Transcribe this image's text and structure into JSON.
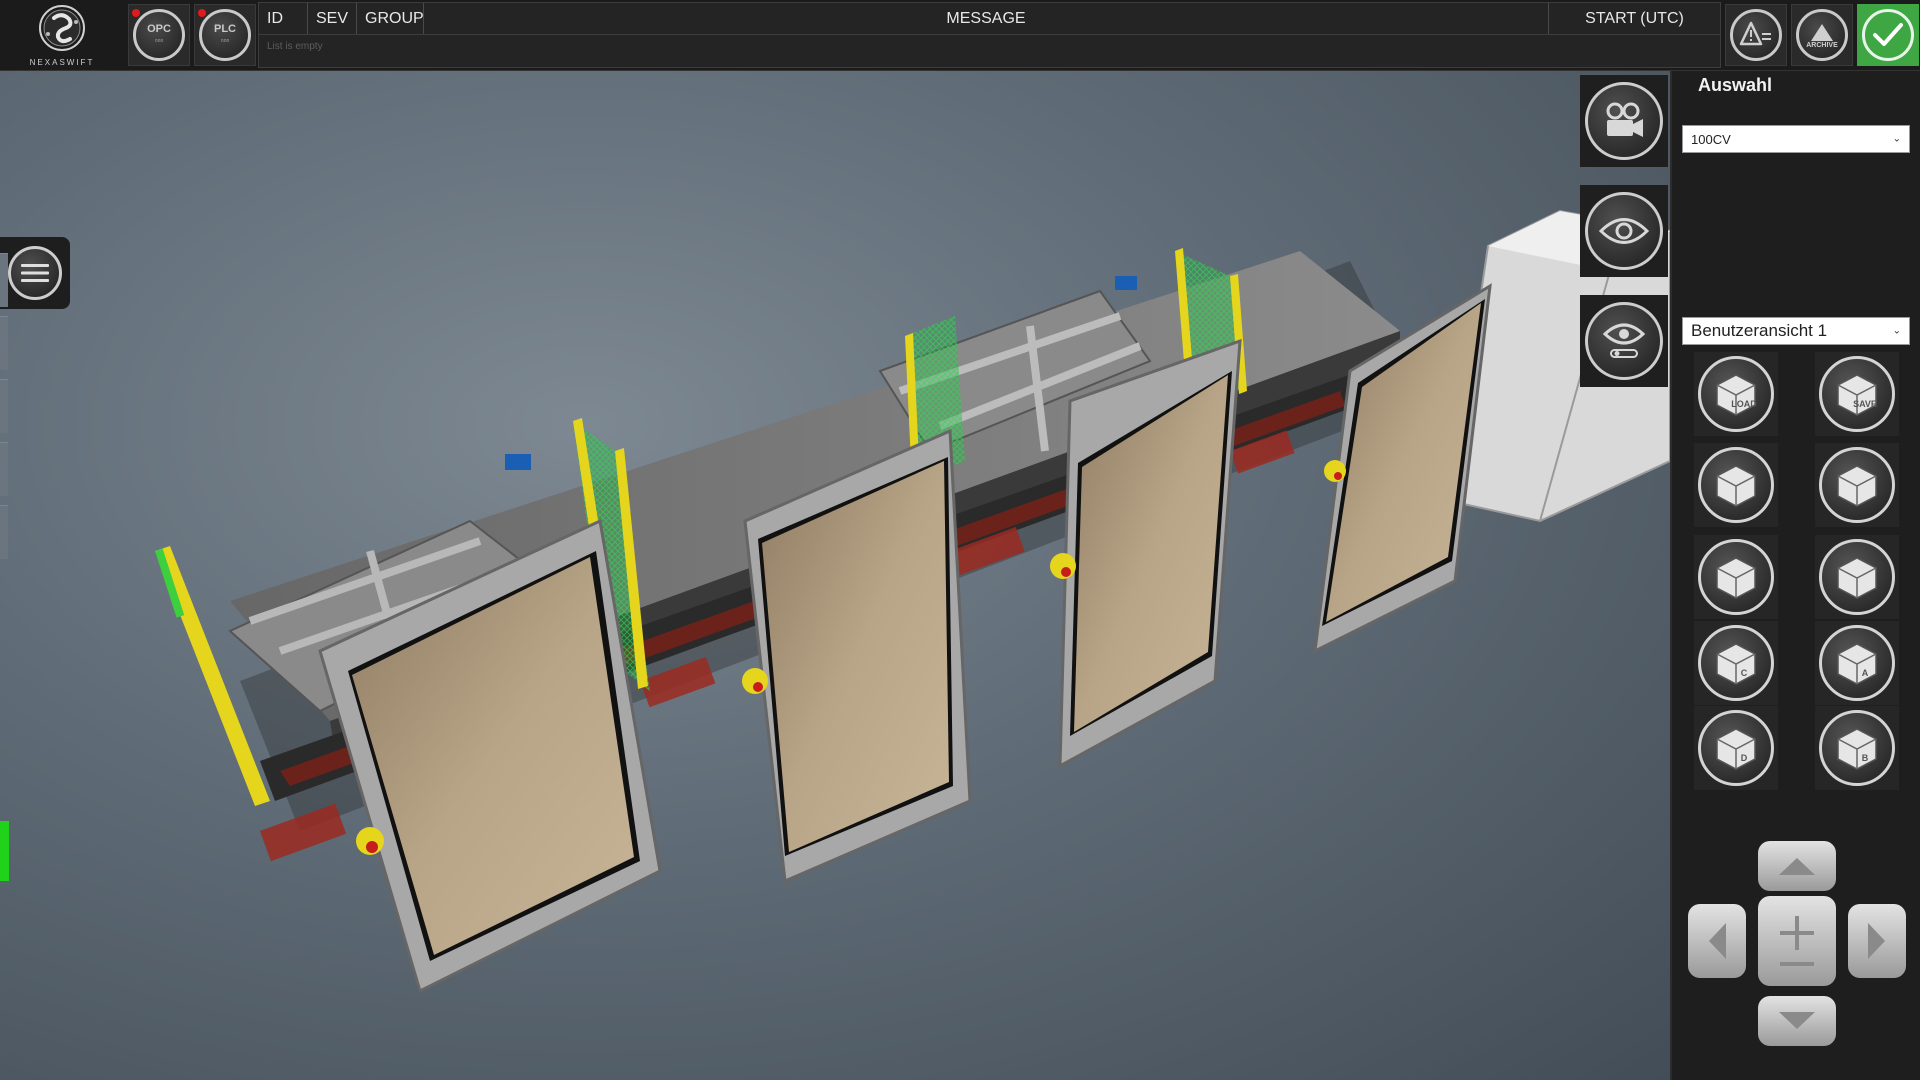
{
  "app": {
    "logo_text": "NEXASWIFT"
  },
  "connections": [
    {
      "name": "opc",
      "label_top": "OPC",
      "label_bottom": "▫▫▫",
      "status": "error"
    },
    {
      "name": "plc",
      "label_top": "PLC",
      "label_bottom": "▫▫▫",
      "status": "error"
    }
  ],
  "messages": {
    "columns": {
      "id": "ID",
      "sev": "SEV",
      "group": "GROUP",
      "message": "MESSAGE",
      "start": "START (UTC)"
    },
    "empty_text": "List is empty"
  },
  "actions": {
    "archive_label": "ARCHIVE"
  },
  "camera_tools": [
    "camera-record",
    "visibility",
    "visibility-settings"
  ],
  "panel": {
    "title": "Auswahl",
    "selection_value": "100CV",
    "view_value": "Benutzeransicht 1",
    "cube_buttons": [
      {
        "name": "load-view",
        "label": "LOAD"
      },
      {
        "name": "save-view",
        "label": "SAVE"
      },
      {
        "name": "reset-camera",
        "label": ""
      },
      {
        "name": "camera-orbit",
        "label": ""
      },
      {
        "name": "view-top",
        "label": ""
      },
      {
        "name": "view-front",
        "label": ""
      },
      {
        "name": "view-c",
        "label": "C"
      },
      {
        "name": "view-a",
        "label": "A"
      },
      {
        "name": "view-d",
        "label": "D"
      },
      {
        "name": "view-b",
        "label": "B"
      }
    ]
  },
  "colors": {
    "status_ok": "#3ea642",
    "status_error": "#e01b1b",
    "light_curtain": "#e5d51c",
    "door_panel": "#b09c80",
    "indicator_green": "#21d21a"
  }
}
